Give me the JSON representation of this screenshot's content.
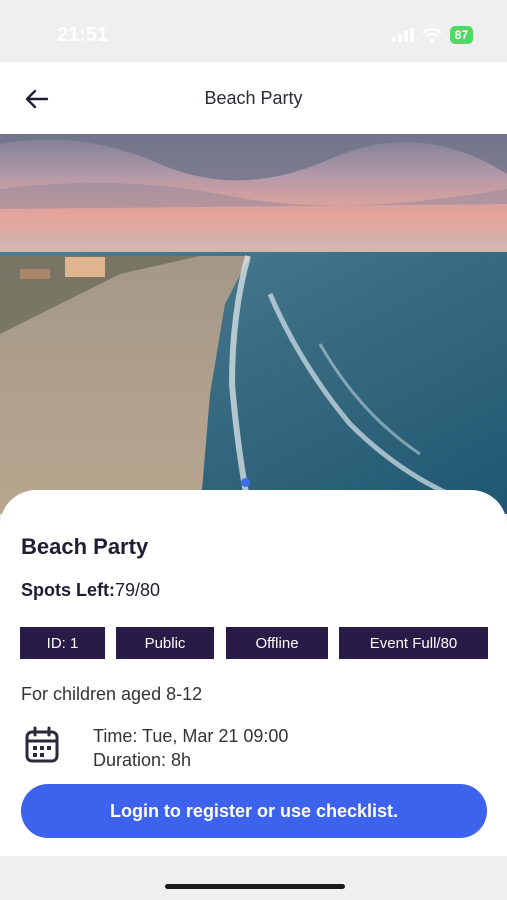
{
  "status_bar": {
    "time": "21:51",
    "battery": "87"
  },
  "nav": {
    "title": "Beach Party",
    "back_icon": "arrow-left-icon"
  },
  "event": {
    "title": "Beach Party",
    "spots_label": "Spots Left:",
    "spots_value": "79/80",
    "tags": [
      "ID: 1",
      "Public",
      "Offline",
      "Event Full/80"
    ],
    "age_text": "For children aged 8-12",
    "time_text": "Time: Tue, Mar 21 09:00",
    "duration_text": "Duration: 8h",
    "calendar_icon": "calendar-icon"
  },
  "cta": {
    "label": "Login to register or use checklist."
  },
  "colors": {
    "tag_bg": "#281b47",
    "button_bg": "#3d62ee",
    "page_dot": "#3b6ef0"
  }
}
